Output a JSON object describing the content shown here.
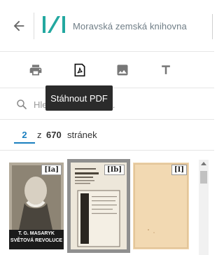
{
  "header": {
    "library_name": "Moravská zemská knihovna",
    "logo_color": "#23a8a0"
  },
  "toolbar": {
    "items": [
      {
        "name": "print",
        "icon": "print-icon"
      },
      {
        "name": "pdf",
        "icon": "pdf-icon"
      },
      {
        "name": "image",
        "icon": "image-icon"
      },
      {
        "name": "text",
        "icon": "text-icon"
      }
    ],
    "tooltip": "Stáhnout PDF"
  },
  "search": {
    "placeholder": "Hledat v publikaci ..."
  },
  "pager": {
    "current": "2",
    "separator": "z",
    "total": "670",
    "unit": "stránek"
  },
  "thumbnails": [
    {
      "label": "[Ia]"
    },
    {
      "label": "[Ib]"
    },
    {
      "label": "[I]"
    }
  ],
  "thumb1_caption": {
    "line1": "T. G. MASARYK",
    "line2": "SVĚTOVÁ REVOLUCE"
  },
  "colors": {
    "accent": "#1a7fbf",
    "tooltip_bg": "#2b2b2b"
  }
}
